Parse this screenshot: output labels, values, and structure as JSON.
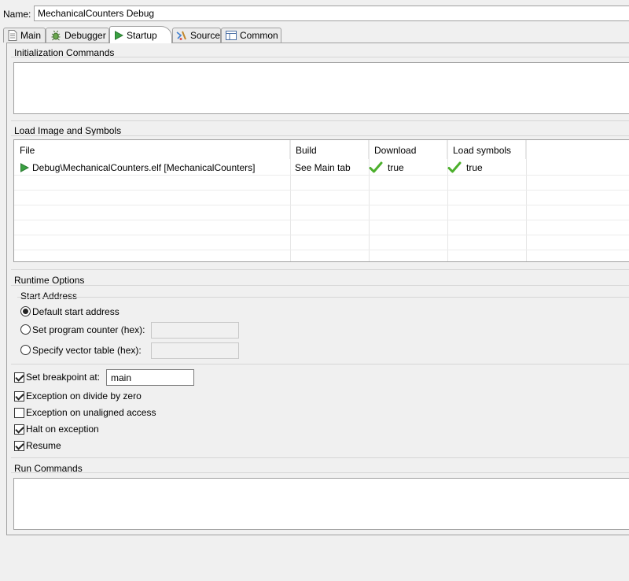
{
  "name": {
    "label": "Name:",
    "value": "MechanicalCounters Debug"
  },
  "tabs": [
    {
      "label": "Main",
      "icon": "document-icon",
      "active": false
    },
    {
      "label": "Debugger",
      "icon": "bug-icon",
      "active": false
    },
    {
      "label": "Startup",
      "icon": "play-icon",
      "active": true
    },
    {
      "label": "Source",
      "icon": "source-icon",
      "active": false
    },
    {
      "label": "Common",
      "icon": "table-icon",
      "active": false
    }
  ],
  "init_commands": {
    "title": "Initialization Commands",
    "value": ""
  },
  "load_image": {
    "title": "Load Image and Symbols",
    "columns": [
      "File",
      "Build",
      "Download",
      "Load symbols"
    ],
    "rows": [
      {
        "file": "Debug\\MechanicalCounters.elf [MechanicalCounters]",
        "build": "See Main tab",
        "download": "true",
        "load_symbols": "true"
      }
    ]
  },
  "runtime": {
    "title": "Runtime Options",
    "start_address": {
      "title": "Start Address",
      "options": [
        {
          "label": "Default start address",
          "checked": true
        },
        {
          "label": "Set program counter (hex):",
          "checked": false
        },
        {
          "label": "Specify vector table (hex):",
          "checked": false
        }
      ]
    },
    "set_breakpoint": {
      "label": "Set breakpoint at:",
      "checked": true,
      "value": "main"
    },
    "checks": [
      {
        "label": "Exception on divide by zero",
        "checked": true
      },
      {
        "label": "Exception on unaligned access",
        "checked": false
      },
      {
        "label": "Halt on exception",
        "checked": true
      },
      {
        "label": "Resume",
        "checked": true
      }
    ]
  },
  "run_commands": {
    "title": "Run Commands",
    "value": ""
  },
  "colors": {
    "accent_green": "#3aa142",
    "check_green": "#4caf2c",
    "border": "#a0a0a0"
  }
}
